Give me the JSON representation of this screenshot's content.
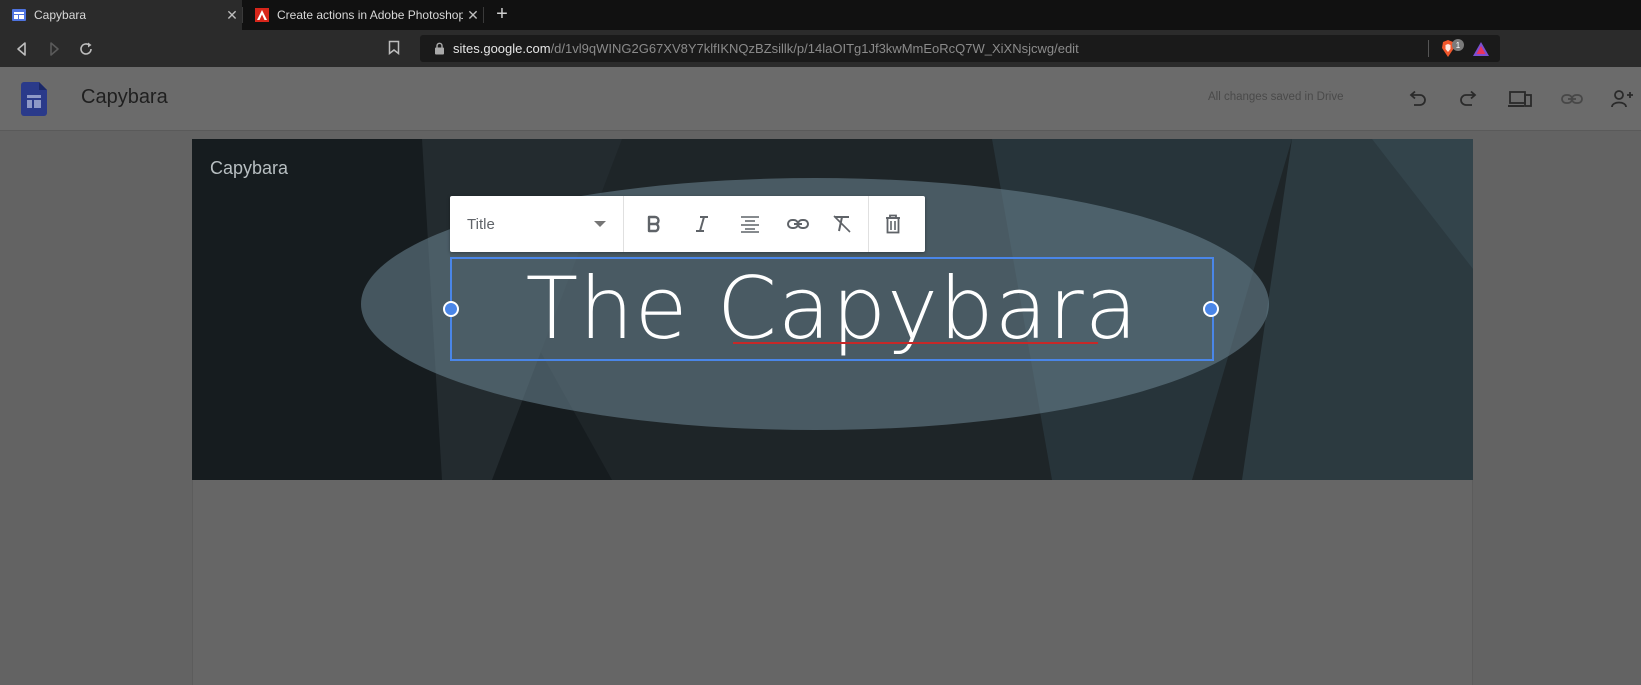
{
  "browser": {
    "tabs": [
      {
        "title": "Capybara",
        "active": true,
        "close": "✕"
      },
      {
        "title": "Create actions in Adobe Photoshop",
        "active": false,
        "close": "✕"
      }
    ],
    "new_tab": "+",
    "url_host": "sites.google.com",
    "url_path": "/d/1vl9qWING2G67XV8Y7klfIKNQzBZsillk/p/14laOITg1Jf3kwMmEoRcQ7W_XiXNsjcwg/edit",
    "extension_badge": "1"
  },
  "app": {
    "title": "Capybara",
    "save_status": "All changes saved in Drive",
    "icons": [
      "undo-icon",
      "redo-icon",
      "preview-icon",
      "link-icon",
      "share-icon"
    ]
  },
  "banner": {
    "site_name": "Capybara"
  },
  "format_toolbar": {
    "style_value": "Title",
    "icons": [
      "bold-icon",
      "italic-icon",
      "align-center-icon",
      "insert-link-icon",
      "clear-formatting-icon",
      "delete-icon"
    ]
  },
  "title_box": {
    "text": "The Capybara"
  },
  "colors": {
    "accent": "#4a86e8",
    "spellcheck": "#c62828",
    "banner_bg": "#1e2528"
  }
}
